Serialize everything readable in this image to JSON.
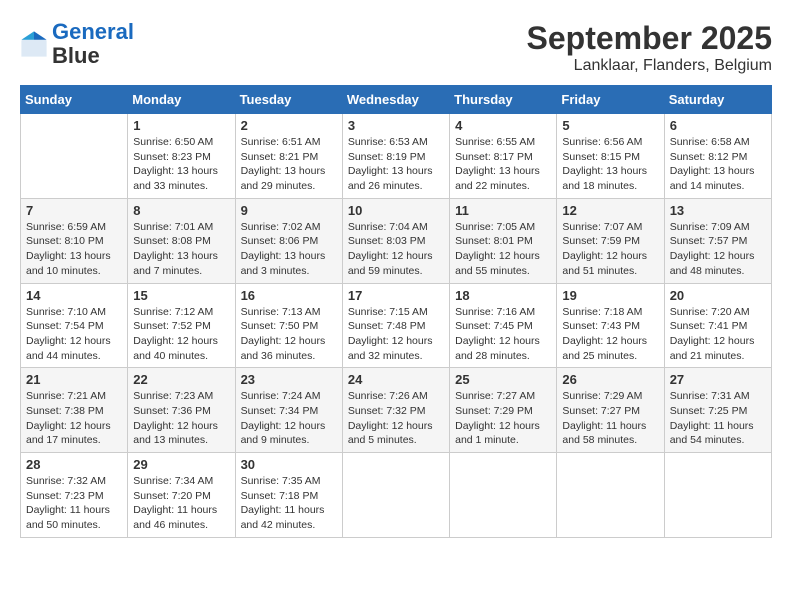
{
  "logo": {
    "line1": "General",
    "line2": "Blue"
  },
  "title": "September 2025",
  "subtitle": "Lanklaar, Flanders, Belgium",
  "weekdays": [
    "Sunday",
    "Monday",
    "Tuesday",
    "Wednesday",
    "Thursday",
    "Friday",
    "Saturday"
  ],
  "weeks": [
    [
      {
        "day": "",
        "info": ""
      },
      {
        "day": "1",
        "info": "Sunrise: 6:50 AM\nSunset: 8:23 PM\nDaylight: 13 hours\nand 33 minutes."
      },
      {
        "day": "2",
        "info": "Sunrise: 6:51 AM\nSunset: 8:21 PM\nDaylight: 13 hours\nand 29 minutes."
      },
      {
        "day": "3",
        "info": "Sunrise: 6:53 AM\nSunset: 8:19 PM\nDaylight: 13 hours\nand 26 minutes."
      },
      {
        "day": "4",
        "info": "Sunrise: 6:55 AM\nSunset: 8:17 PM\nDaylight: 13 hours\nand 22 minutes."
      },
      {
        "day": "5",
        "info": "Sunrise: 6:56 AM\nSunset: 8:15 PM\nDaylight: 13 hours\nand 18 minutes."
      },
      {
        "day": "6",
        "info": "Sunrise: 6:58 AM\nSunset: 8:12 PM\nDaylight: 13 hours\nand 14 minutes."
      }
    ],
    [
      {
        "day": "7",
        "info": "Sunrise: 6:59 AM\nSunset: 8:10 PM\nDaylight: 13 hours\nand 10 minutes."
      },
      {
        "day": "8",
        "info": "Sunrise: 7:01 AM\nSunset: 8:08 PM\nDaylight: 13 hours\nand 7 minutes."
      },
      {
        "day": "9",
        "info": "Sunrise: 7:02 AM\nSunset: 8:06 PM\nDaylight: 13 hours\nand 3 minutes."
      },
      {
        "day": "10",
        "info": "Sunrise: 7:04 AM\nSunset: 8:03 PM\nDaylight: 12 hours\nand 59 minutes."
      },
      {
        "day": "11",
        "info": "Sunrise: 7:05 AM\nSunset: 8:01 PM\nDaylight: 12 hours\nand 55 minutes."
      },
      {
        "day": "12",
        "info": "Sunrise: 7:07 AM\nSunset: 7:59 PM\nDaylight: 12 hours\nand 51 minutes."
      },
      {
        "day": "13",
        "info": "Sunrise: 7:09 AM\nSunset: 7:57 PM\nDaylight: 12 hours\nand 48 minutes."
      }
    ],
    [
      {
        "day": "14",
        "info": "Sunrise: 7:10 AM\nSunset: 7:54 PM\nDaylight: 12 hours\nand 44 minutes."
      },
      {
        "day": "15",
        "info": "Sunrise: 7:12 AM\nSunset: 7:52 PM\nDaylight: 12 hours\nand 40 minutes."
      },
      {
        "day": "16",
        "info": "Sunrise: 7:13 AM\nSunset: 7:50 PM\nDaylight: 12 hours\nand 36 minutes."
      },
      {
        "day": "17",
        "info": "Sunrise: 7:15 AM\nSunset: 7:48 PM\nDaylight: 12 hours\nand 32 minutes."
      },
      {
        "day": "18",
        "info": "Sunrise: 7:16 AM\nSunset: 7:45 PM\nDaylight: 12 hours\nand 28 minutes."
      },
      {
        "day": "19",
        "info": "Sunrise: 7:18 AM\nSunset: 7:43 PM\nDaylight: 12 hours\nand 25 minutes."
      },
      {
        "day": "20",
        "info": "Sunrise: 7:20 AM\nSunset: 7:41 PM\nDaylight: 12 hours\nand 21 minutes."
      }
    ],
    [
      {
        "day": "21",
        "info": "Sunrise: 7:21 AM\nSunset: 7:38 PM\nDaylight: 12 hours\nand 17 minutes."
      },
      {
        "day": "22",
        "info": "Sunrise: 7:23 AM\nSunset: 7:36 PM\nDaylight: 12 hours\nand 13 minutes."
      },
      {
        "day": "23",
        "info": "Sunrise: 7:24 AM\nSunset: 7:34 PM\nDaylight: 12 hours\nand 9 minutes."
      },
      {
        "day": "24",
        "info": "Sunrise: 7:26 AM\nSunset: 7:32 PM\nDaylight: 12 hours\nand 5 minutes."
      },
      {
        "day": "25",
        "info": "Sunrise: 7:27 AM\nSunset: 7:29 PM\nDaylight: 12 hours\nand 1 minute."
      },
      {
        "day": "26",
        "info": "Sunrise: 7:29 AM\nSunset: 7:27 PM\nDaylight: 11 hours\nand 58 minutes."
      },
      {
        "day": "27",
        "info": "Sunrise: 7:31 AM\nSunset: 7:25 PM\nDaylight: 11 hours\nand 54 minutes."
      }
    ],
    [
      {
        "day": "28",
        "info": "Sunrise: 7:32 AM\nSunset: 7:23 PM\nDaylight: 11 hours\nand 50 minutes."
      },
      {
        "day": "29",
        "info": "Sunrise: 7:34 AM\nSunset: 7:20 PM\nDaylight: 11 hours\nand 46 minutes."
      },
      {
        "day": "30",
        "info": "Sunrise: 7:35 AM\nSunset: 7:18 PM\nDaylight: 11 hours\nand 42 minutes."
      },
      {
        "day": "",
        "info": ""
      },
      {
        "day": "",
        "info": ""
      },
      {
        "day": "",
        "info": ""
      },
      {
        "day": "",
        "info": ""
      }
    ]
  ]
}
